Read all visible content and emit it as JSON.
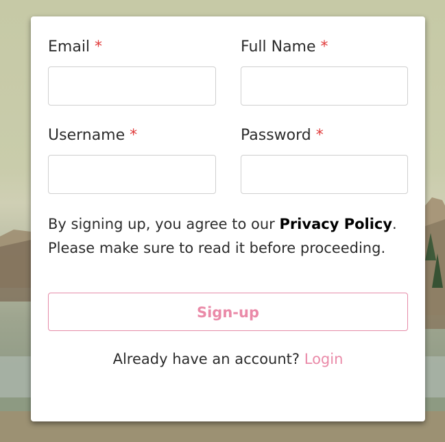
{
  "form": {
    "email_label": "Email",
    "fullname_label": "Full Name",
    "username_label": "Username",
    "password_label": "Password",
    "required_marker": "*",
    "email_value": "",
    "fullname_value": "",
    "username_value": "",
    "password_value": ""
  },
  "policy": {
    "text_before": "By signing up, you agree to our ",
    "link": "Privacy Policy",
    "text_after": ".",
    "line2": "Please make sure to read it before proceeding."
  },
  "actions": {
    "signup_label": "Sign-up",
    "login_prompt": "Already have an account? ",
    "login_link": "Login"
  },
  "colors": {
    "accent": "#ea8aa8",
    "required": "#e03b3b",
    "card": "#ffffff"
  }
}
